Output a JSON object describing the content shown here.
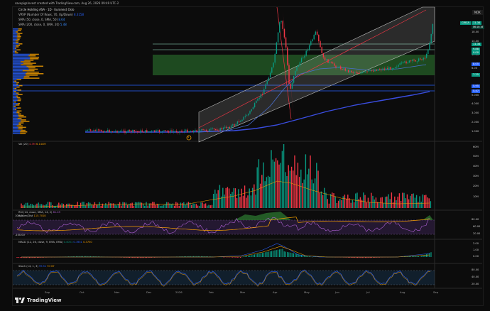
{
  "header": {
    "created": "savepigsinvest created with TradingView.com, Aug 26, 2026 09:49 UTC-2",
    "symbol_line": "Circle Holding ASA · 1D · Euronext Oslo",
    "vrvp": "VRVP (Number Of Rows, 70, Up/Down)",
    "vrvp_val": "8.3158",
    "sma50": "SMA (50, close, 0, SMA, 50)",
    "sma50_val": "8.64",
    "sma200": "SMA (200, close, 0, SMA, 20)",
    "sma200_val": "5.48"
  },
  "top_button": "NOK",
  "price_axis": {
    "labels": [
      "18.00",
      "14.00",
      "10.00",
      "8.00",
      "6.00",
      "5.000",
      "4.000",
      "3.000",
      "2.000",
      "1.000"
    ],
    "tags": [
      {
        "text": "11.34",
        "color": "#089981"
      },
      {
        "text": "9.88",
        "color": "#089981"
      },
      {
        "text": "9.00",
        "color": "#089981"
      },
      {
        "text": "8.05",
        "color": "#089981"
      },
      {
        "text": "7.25",
        "color": "#089981"
      },
      {
        "text": "5.95",
        "color": "#2962ff"
      },
      {
        "text": "5.47",
        "color": "#2962ff"
      }
    ],
    "current_tag": "CIRCA",
    "current_val": "11.34",
    "current_time": "06:10:16"
  },
  "volume": {
    "label": "Vol (20)",
    "v1": "4.3M",
    "v2": "6.144M",
    "axis": [
      "60M",
      "50M",
      "40M",
      "30M",
      "20M",
      "10M"
    ]
  },
  "rsi": {
    "label": "RSI (14, close, SMA, 14, 2)",
    "val": "81.49",
    "label2": "Accum/Dist",
    "val2": "115.701K",
    "axis": [
      "100.00",
      "80.00",
      "60.00",
      "20.00",
      "-100.00"
    ]
  },
  "macd": {
    "label": "MACD (12, 26, close, 9, EMA, EMA)",
    "v1": "0.4051",
    "v2": "0.7851",
    "v3": "0.3750",
    "axis": [
      "2.00",
      "1.00",
      "0.00"
    ]
  },
  "stoch": {
    "label": "Stoch (14, 1, 3)",
    "v1": "99.51",
    "v2": "97.67",
    "axis": [
      "80.00",
      "40.00",
      "20.00"
    ]
  },
  "time_axis": [
    "Sep",
    "Oct",
    "Nov",
    "Dec",
    "2026",
    "Feb",
    "Mar",
    "Apr",
    "May",
    "Jun",
    "Jul",
    "Aug",
    "Sep"
  ],
  "event_marker": "S",
  "brand": "TradingView",
  "colors": {
    "up": "#089981",
    "down": "#f23645",
    "channel": "#c8c8c8",
    "zone": "#2e7d32",
    "vp_up": "#2962ff",
    "vp_down": "#f6a000",
    "sma": "#3a4de0"
  }
}
